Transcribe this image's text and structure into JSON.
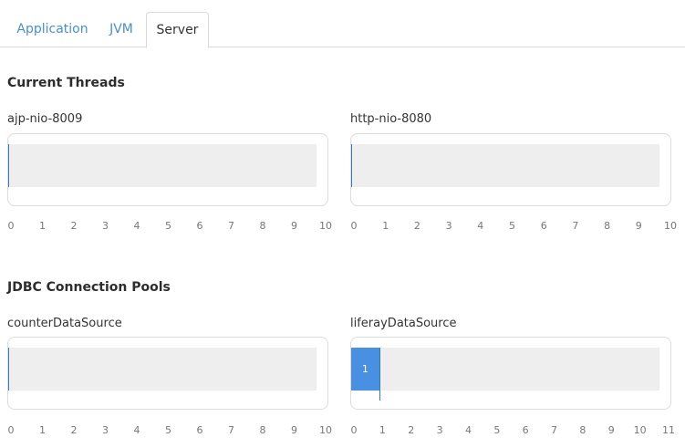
{
  "tabs": [
    {
      "label": "Application",
      "active": false
    },
    {
      "label": "JVM",
      "active": false
    },
    {
      "label": "Server",
      "active": true
    }
  ],
  "sections": {
    "threads_title": "Current Threads",
    "jdbc_title": "JDBC Connection Pools"
  },
  "colors": {
    "accent": "#4a90e2",
    "track": "#eeeeee",
    "link": "#4a90c8"
  },
  "chart_data": [
    {
      "type": "bar",
      "title": "ajp-nio-8009",
      "value": 0,
      "xlim": [
        0,
        10
      ],
      "ticks": [
        "0",
        "1",
        "2",
        "3",
        "4",
        "5",
        "6",
        "7",
        "8",
        "9",
        "10"
      ]
    },
    {
      "type": "bar",
      "title": "http-nio-8080",
      "value": 0,
      "xlim": [
        0,
        10
      ],
      "ticks": [
        "0",
        "1",
        "2",
        "3",
        "4",
        "5",
        "6",
        "7",
        "8",
        "9",
        "10"
      ]
    },
    {
      "type": "bar",
      "title": "counterDataSource",
      "value": 0,
      "xlim": [
        0,
        10
      ],
      "ticks": [
        "0",
        "1",
        "2",
        "3",
        "4",
        "5",
        "6",
        "7",
        "8",
        "9",
        "10"
      ]
    },
    {
      "type": "bar",
      "title": "liferayDataSource",
      "value": 1,
      "data_label": "1",
      "xlim": [
        0,
        11
      ],
      "ticks": [
        "0",
        "1",
        "2",
        "3",
        "4",
        "5",
        "6",
        "7",
        "8",
        "9",
        "10",
        "11"
      ]
    }
  ]
}
